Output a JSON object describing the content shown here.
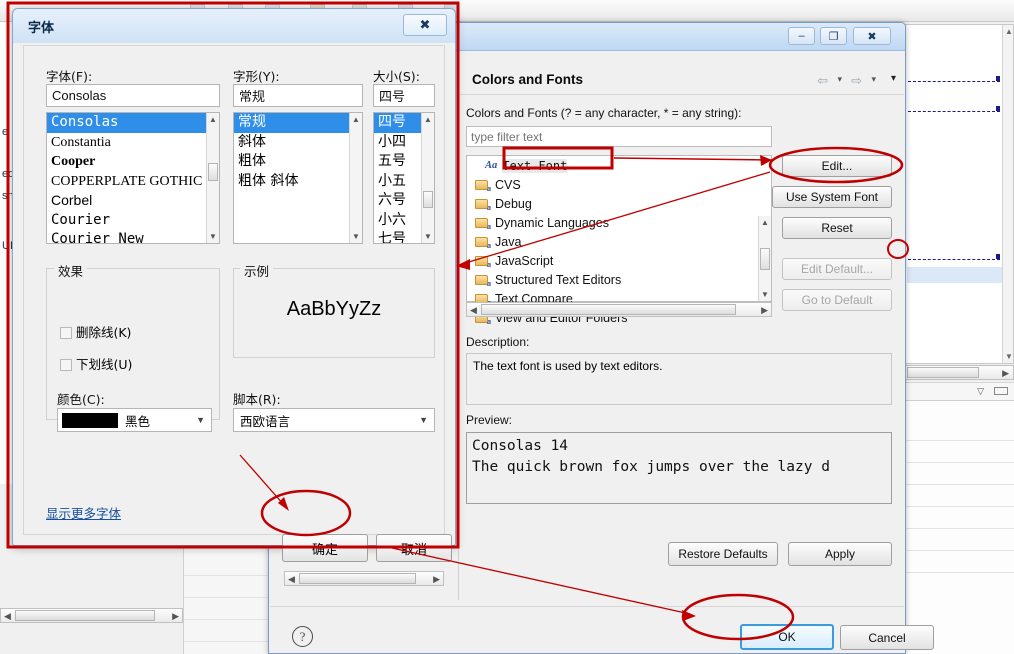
{
  "background": {
    "left_panel_fragments": [
      "e",
      "ed",
      "sno",
      "",
      "URI"
    ],
    "editor_scroll": "editor-scrollbar"
  },
  "prefs_dialog": {
    "window_controls": {
      "minimize": "–",
      "maximize": "❐",
      "close": "✖"
    },
    "page_title": "Colors and Fonts",
    "nav": {
      "back": "⇦",
      "back_menu": "▾",
      "forward": "⇨",
      "forward_menu": "▾",
      "view_menu": "▾"
    },
    "filter_label": "Colors and Fonts (? = any character, * = any string):",
    "filter_placeholder": "type filter text",
    "filter_value": "",
    "tree": [
      {
        "label": "Text Font",
        "icon": "aa-font-icon",
        "selected": true,
        "highlighted": true
      },
      {
        "label": "CVS",
        "icon": "folder-font-icon",
        "selected": false
      },
      {
        "label": "Debug",
        "icon": "folder-font-icon",
        "selected": false
      },
      {
        "label": "Dynamic Languages",
        "icon": "folder-font-icon",
        "selected": false
      },
      {
        "label": "Java",
        "icon": "folder-font-icon",
        "selected": false
      },
      {
        "label": "JavaScript",
        "icon": "folder-font-icon",
        "selected": false
      },
      {
        "label": "Structured Text Editors",
        "icon": "folder-font-icon",
        "selected": false
      },
      {
        "label": "Text Compare",
        "icon": "folder-font-icon",
        "selected": false
      },
      {
        "label": "View and Editor Folders",
        "icon": "folder-font-icon",
        "selected": false
      }
    ],
    "side_buttons": [
      {
        "label": "Edit...",
        "enabled": true
      },
      {
        "label": "Use System Font",
        "enabled": true
      },
      {
        "label": "Reset",
        "enabled": true
      },
      {
        "label": "Edit Default...",
        "enabled": false
      },
      {
        "label": "Go to Default",
        "enabled": false
      }
    ],
    "description_label": "Description:",
    "description_text": "The text font is used by text editors.",
    "preview_label": "Preview:",
    "preview_lines": [
      "Consolas 14",
      "The quick brown fox jumps over the lazy d"
    ],
    "footer_buttons": [
      {
        "label": "Restore Defaults",
        "default": false
      },
      {
        "label": "Apply",
        "default": false
      }
    ],
    "help_icon": "?",
    "bottom_buttons": [
      {
        "label": "OK",
        "default": true
      },
      {
        "label": "Cancel",
        "default": false
      }
    ]
  },
  "font_dialog": {
    "title": "字体",
    "close_label": "✖",
    "font_label": "字体(F):",
    "font_value": "Consolas",
    "font_list": [
      {
        "name": "Consolas",
        "selected": true,
        "style": "mono"
      },
      {
        "name": "Constantia",
        "selected": false,
        "style": "serif"
      },
      {
        "name": "Cooper",
        "selected": false,
        "style": "bold-serif"
      },
      {
        "name": "COPPERPLATE GOTHIC",
        "selected": false,
        "style": "caps"
      },
      {
        "name": "Corbel",
        "selected": false,
        "style": "sans"
      },
      {
        "name": "Courier",
        "selected": false,
        "style": "mono"
      },
      {
        "name": "Courier New",
        "selected": false,
        "style": "mono"
      }
    ],
    "style_label": "字形(Y):",
    "style_value": "常规",
    "style_list": [
      {
        "name": "常规",
        "selected": true
      },
      {
        "name": "斜体",
        "selected": false
      },
      {
        "name": "粗体",
        "selected": false
      },
      {
        "name": "粗体 斜体",
        "selected": false
      }
    ],
    "size_label": "大小(S):",
    "size_value": "四号",
    "size_list": [
      {
        "name": "四号",
        "selected": true
      },
      {
        "name": "小四",
        "selected": false
      },
      {
        "name": "五号",
        "selected": false
      },
      {
        "name": "小五",
        "selected": false
      },
      {
        "name": "六号",
        "selected": false
      },
      {
        "name": "小六",
        "selected": false
      },
      {
        "name": "七号",
        "selected": false
      }
    ],
    "effects_title": "效果",
    "effect_strikeout": "删除线(K)",
    "effect_underline": "下划线(U)",
    "strikeout_checked": false,
    "underline_checked": false,
    "color_label": "颜色(C):",
    "color_value": "黑色",
    "color_hex": "#000000",
    "sample_title": "示例",
    "sample_text": "AaBbYyZz",
    "script_label": "脚本(R):",
    "script_value": "西欧语言",
    "more_fonts_link": "显示更多字体",
    "ok_label": "确定",
    "cancel_label": "取消"
  },
  "annotations": {
    "color": "#c00000",
    "highlight_boxes": [
      "font-dialog-outline",
      "text-font-tree-item"
    ],
    "ellipses": [
      "edit-button",
      "ok-button-cn",
      "ok-button-eclipse"
    ],
    "arrows": [
      "tree-item-to-edit",
      "edit-to-font-dialog",
      "confirm-arrow",
      "cn-ok-to-eclipse-ok"
    ]
  }
}
